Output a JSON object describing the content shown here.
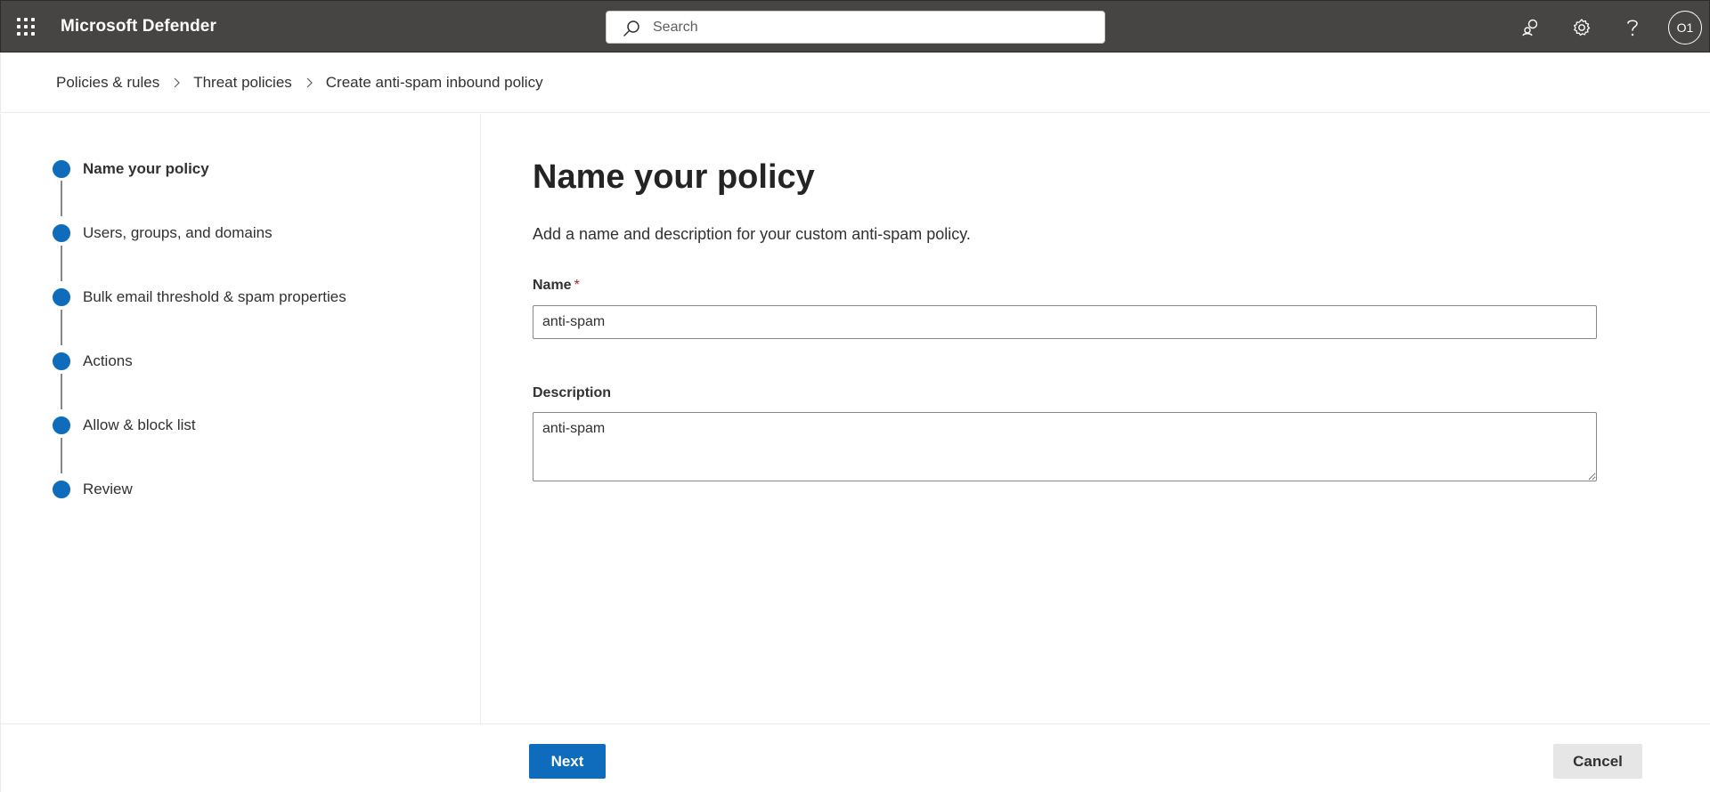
{
  "header": {
    "app_title": "Microsoft Defender",
    "search_placeholder": "Search",
    "avatar_initials": "O1",
    "icons": [
      "waffle-icon",
      "search-icon",
      "community-icon",
      "gear-icon",
      "help-icon"
    ],
    "colors": {
      "bar_bg": "#464543",
      "accent": "#0f6cbd"
    }
  },
  "breadcrumb": {
    "items": [
      "Policies & rules",
      "Threat policies",
      "Create anti-spam inbound policy"
    ]
  },
  "wizard": {
    "steps": [
      {
        "label": "Name your policy",
        "active": true
      },
      {
        "label": "Users, groups, and domains",
        "active": false
      },
      {
        "label": "Bulk email threshold & spam properties",
        "active": false
      },
      {
        "label": "Actions",
        "active": false
      },
      {
        "label": "Allow & block list",
        "active": false
      },
      {
        "label": "Review",
        "active": false
      }
    ]
  },
  "main": {
    "title": "Name your policy",
    "description": "Add a name and description for your custom anti-spam policy.",
    "name_field": {
      "label": "Name",
      "required_mark": "*",
      "value": "anti-spam"
    },
    "description_field": {
      "label": "Description",
      "value": "anti-spam"
    }
  },
  "footer": {
    "next_label": "Next",
    "cancel_label": "Cancel"
  }
}
